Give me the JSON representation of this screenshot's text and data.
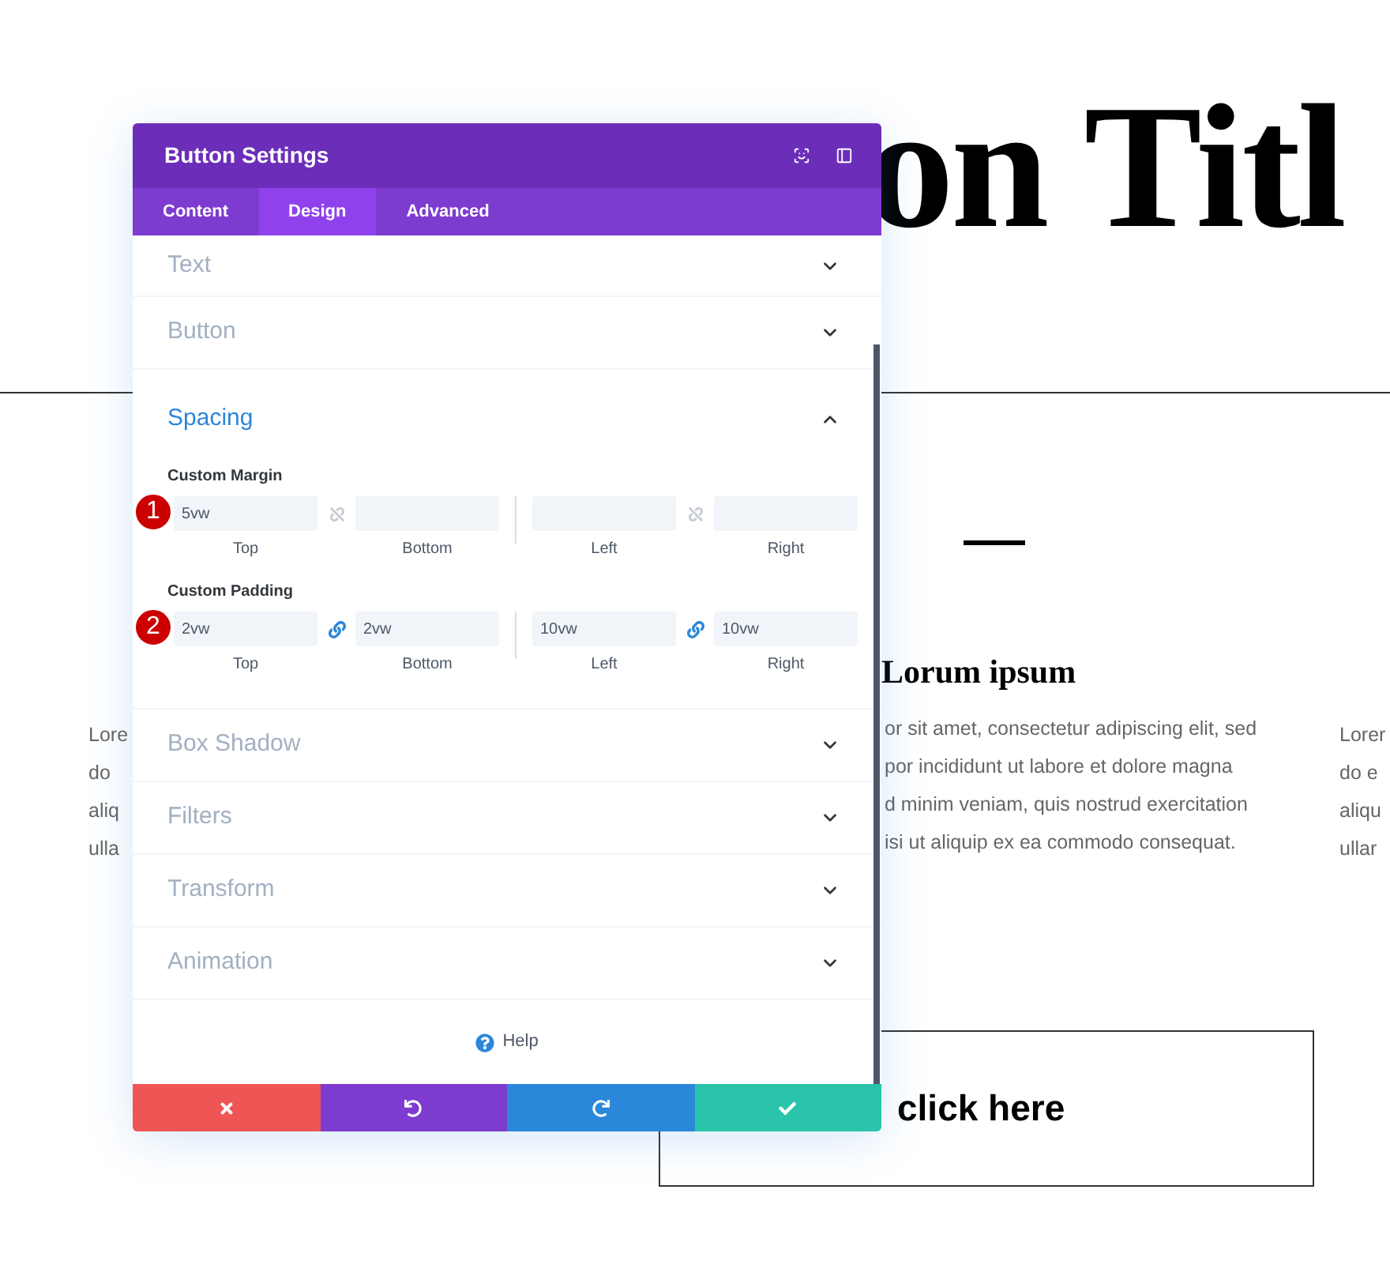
{
  "page": {
    "title": "on Titl",
    "subheading": "Lorum ipsum",
    "left_column": [
      "Lore",
      "do",
      "aliq",
      "ulla"
    ],
    "middle_column": [
      "or sit amet, consectetur adipiscing elit, sed",
      "por incididunt ut labore et dolore magna",
      "d minim veniam, quis nostrud exercitation",
      "isi ut aliquip ex ea commodo consequat."
    ],
    "right_column": [
      "Lorer",
      "do e",
      "aliqu",
      "ullar"
    ],
    "button": "click here"
  },
  "window": {
    "title": "Button Settings"
  },
  "tabs": [
    {
      "label": "Content",
      "selected": false
    },
    {
      "label": "Design",
      "selected": true
    },
    {
      "label": "Advanced",
      "selected": false
    }
  ],
  "sections": [
    {
      "title": "Text",
      "expanded": false
    },
    {
      "title": "Button",
      "expanded": false
    },
    {
      "title": "Spacing",
      "expanded": true,
      "groups": [
        {
          "label": "Custom Margin",
          "badge": "1",
          "pairs": [
            {
              "linked": false,
              "fields": [
                {
                  "label": "Top",
                  "value": "5vw"
                },
                {
                  "label": "Bottom"
                }
              ]
            },
            {
              "linked": false,
              "fields": [
                {
                  "label": "Left"
                },
                {
                  "label": "Right"
                }
              ]
            }
          ]
        },
        {
          "label": "Custom Padding",
          "badge": "2",
          "pairs": [
            {
              "linked": true,
              "fields": [
                {
                  "label": "Top",
                  "value": "2vw"
                },
                {
                  "label": "Bottom",
                  "value": "2vw"
                }
              ]
            },
            {
              "linked": true,
              "fields": [
                {
                  "label": "Left",
                  "value": "10vw"
                },
                {
                  "label": "Right",
                  "value": "10vw"
                }
              ]
            }
          ]
        }
      ]
    },
    {
      "title": "Box Shadow",
      "expanded": false
    },
    {
      "title": "Filters",
      "expanded": false
    },
    {
      "title": "Transform",
      "expanded": false
    },
    {
      "title": "Animation",
      "expanded": false
    }
  ],
  "help": "Help",
  "footer": [
    {
      "kind": "cancel"
    },
    {
      "kind": "undo"
    },
    {
      "kind": "redo"
    },
    {
      "kind": "save"
    }
  ]
}
